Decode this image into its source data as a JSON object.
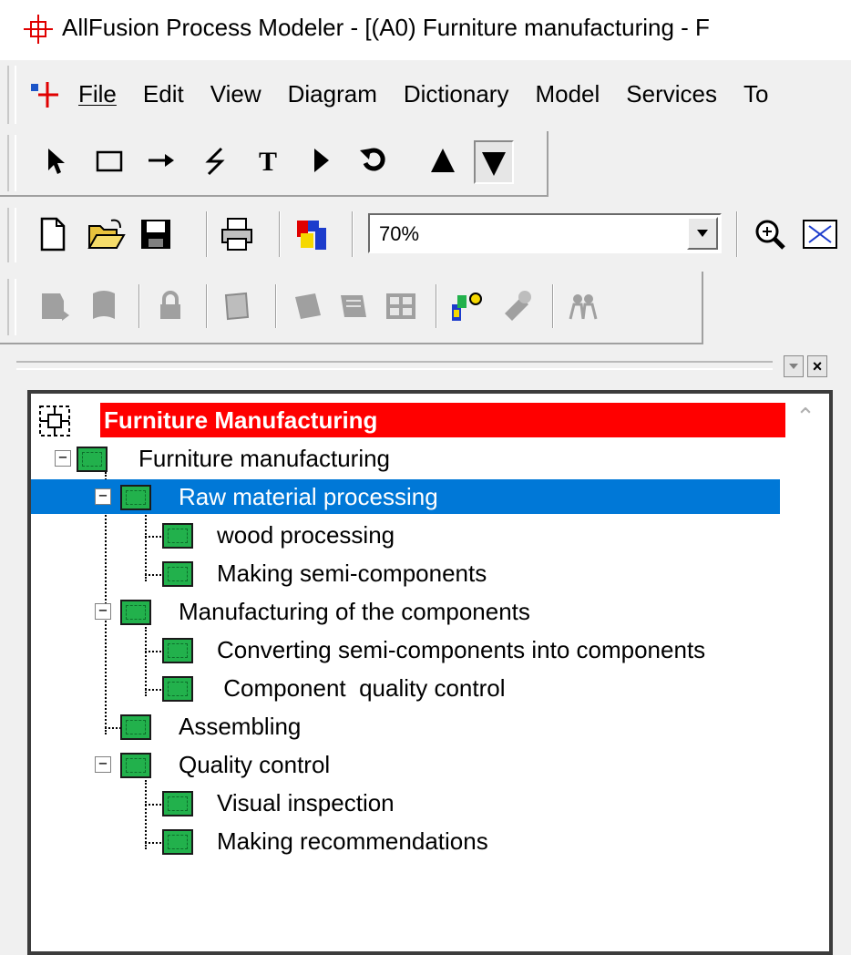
{
  "app": {
    "title": "AllFusion Process Modeler - [(A0) Furniture manufacturing - F"
  },
  "menu": {
    "items": [
      "File",
      "Edit",
      "View",
      "Diagram",
      "Dictionary",
      "Model",
      "Services",
      "To"
    ]
  },
  "toolbar_draw": {
    "tools": [
      "pointer-tool-icon",
      "box-tool-icon",
      "arrow-tool-icon",
      "squiggle-tool-icon",
      "text-tool-icon",
      "off-page-reference-icon",
      "undo-icon",
      "go-up-icon",
      "go-down-icon"
    ]
  },
  "toolbar_standard": {
    "zoom_value": "70%"
  },
  "tree": {
    "root_label": "Furniture Manufacturing",
    "nodes": [
      "Furniture manufacturing",
      "Raw material  processing",
      "wood processing",
      "Making semi-components",
      "Manufacturing  of the components",
      "Converting semi-components into components",
      " Component  quality control",
      "Assembling",
      "Quality control",
      "Visual inspection",
      "Making recommendations"
    ],
    "selected": "Raw material  processing"
  },
  "colors": {
    "root_highlight": "#ff0000",
    "selection": "#0078d7",
    "node_icon": "#22b14c"
  }
}
